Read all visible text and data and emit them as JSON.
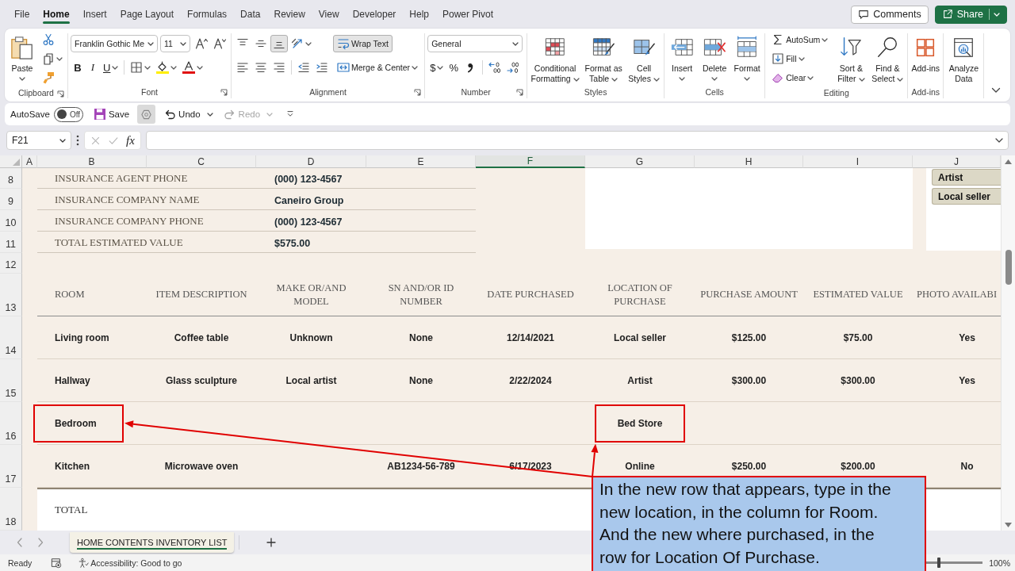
{
  "menu_tabs": [
    {
      "label": "File",
      "selected": false
    },
    {
      "label": "Home",
      "selected": true
    },
    {
      "label": "Insert",
      "selected": false
    },
    {
      "label": "Page Layout",
      "selected": false
    },
    {
      "label": "Formulas",
      "selected": false
    },
    {
      "label": "Data",
      "selected": false
    },
    {
      "label": "Review",
      "selected": false
    },
    {
      "label": "View",
      "selected": false
    },
    {
      "label": "Developer",
      "selected": false
    },
    {
      "label": "Help",
      "selected": false
    },
    {
      "label": "Power Pivot",
      "selected": false
    }
  ],
  "header_buttons": [
    {
      "label": "Comments",
      "kind": "outline"
    },
    {
      "label": "Share",
      "kind": "primary"
    }
  ],
  "ribbon": {
    "groups": [
      {
        "label": "Clipboard",
        "launcher": true,
        "sections": [
          {
            "kind": "large",
            "label": "Paste",
            "caret": true
          },
          {
            "kind": "stack",
            "lines": [
              {
                "items": [
                  {
                    "kind": "icon"
                  }
                ]
              },
              {
                "items": [
                  {
                    "kind": "icon",
                    "caret": true
                  }
                ]
              },
              {
                "items": [
                  {
                    "kind": "icon"
                  }
                ]
              }
            ]
          }
        ]
      },
      {
        "label": "Font",
        "launcher": true,
        "sections": [
          {
            "kind": "stack",
            "lines": [
              {
                "items": [
                  {
                    "kind": "dropdown",
                    "value": "Franklin Gothic Me"
                  },
                  {
                    "kind": "dropdown",
                    "value": "11"
                  },
                  {
                    "kind": "icon"
                  },
                  {
                    "kind": "icon"
                  }
                ]
              },
              {
                "items": [
                  {
                    "kind": "bold",
                    "label": "B"
                  },
                  {
                    "kind": "italic",
                    "label": "I"
                  },
                  {
                    "kind": "underline",
                    "label": "U",
                    "caret": true
                  },
                  {
                    "kind": "divider"
                  },
                  {
                    "kind": "icon",
                    "caret": true
                  },
                  {
                    "kind": "icon",
                    "caret": true
                  },
                  {
                    "kind": "icon",
                    "caret": true
                  }
                ]
              }
            ]
          }
        ]
      },
      {
        "label": "Alignment",
        "launcher": true,
        "sections": [
          {
            "kind": "stack",
            "lines": [
              {
                "items": [
                  {
                    "kind": "icon",
                    "selected": false
                  },
                  {
                    "kind": "icon",
                    "selected": false
                  },
                  {
                    "kind": "icon",
                    "selected": true
                  },
                  {
                    "kind": "icon",
                    "caret": true
                  }
                ]
              },
              {
                "items": [
                  {
                    "kind": "icon",
                    "selected": false
                  },
                  {
                    "kind": "icon",
                    "selected": false
                  },
                  {
                    "kind": "icon",
                    "selected": false
                  },
                  {
                    "kind": "divider"
                  },
                  {
                    "kind": "icon"
                  },
                  {
                    "kind": "icon"
                  }
                ]
              }
            ]
          },
          {
            "kind": "stack",
            "lines": [
              {
                "items": [
                  {
                    "kind": "labeled",
                    "label": "Wrap Text",
                    "selected": true
                  }
                ]
              },
              {
                "items": [
                  {
                    "kind": "labeled",
                    "label": "Merge & Center",
                    "caret": true
                  }
                ]
              }
            ]
          }
        ]
      },
      {
        "label": "Number",
        "launcher": true,
        "sections": [
          {
            "kind": "stack",
            "lines": [
              {
                "items": [
                  {
                    "kind": "dropdown",
                    "value": "General"
                  }
                ]
              },
              {
                "items": [
                  {
                    "kind": "symbol",
                    "label": "$",
                    "caret": true
                  },
                  {
                    "kind": "symbol",
                    "label": "%"
                  },
                  {
                    "kind": "icon"
                  },
                  {
                    "kind": "divider"
                  },
                  {
                    "kind": "icon"
                  },
                  {
                    "kind": "icon"
                  }
                ]
              }
            ]
          }
        ]
      },
      {
        "label": "Styles",
        "sections": [
          {
            "kind": "large",
            "label": "Conditional Formatting",
            "caret": true
          },
          {
            "kind": "large",
            "label": "Format as Table",
            "caret": true
          },
          {
            "kind": "large",
            "label": "Cell Styles",
            "caret": true
          }
        ]
      },
      {
        "label": "Cells",
        "sections": [
          {
            "kind": "large",
            "label": "Insert",
            "caret": true
          },
          {
            "kind": "large",
            "label": "Delete",
            "caret": true
          },
          {
            "kind": "large",
            "label": "Format",
            "caret": true
          }
        ]
      },
      {
        "label": "Editing",
        "sections": [
          {
            "kind": "stack",
            "lines": [
              {
                "items": [
                  {
                    "kind": "labeled",
                    "label": "AutoSum",
                    "caret": true
                  }
                ]
              },
              {
                "items": [
                  {
                    "kind": "labeled",
                    "label": "Fill",
                    "caret": true
                  }
                ]
              },
              {
                "items": [
                  {
                    "kind": "labeled",
                    "label": "Clear",
                    "caret": true
                  }
                ]
              }
            ]
          },
          {
            "kind": "large",
            "label": "Sort & Filter",
            "caret": true
          },
          {
            "kind": "large",
            "label": "Find & Select",
            "caret": true
          }
        ]
      },
      {
        "label": "Add-ins",
        "sections": [
          {
            "kind": "large",
            "label": "Add-ins"
          }
        ]
      },
      {
        "sections": [
          {
            "kind": "large",
            "label": "Analyze Data"
          }
        ]
      }
    ]
  },
  "quick_access": [
    {
      "kind": "toggle",
      "label": "AutoSave",
      "state": "Off",
      "on": false
    },
    {
      "kind": "button",
      "label": "Save",
      "disabled": false
    },
    {
      "kind": "icon",
      "selected": true
    },
    {
      "kind": "button",
      "label": "Undo",
      "caret": true,
      "disabled": false
    },
    {
      "kind": "button",
      "label": "Redo",
      "caret": true,
      "disabled": true
    },
    {
      "kind": "menu"
    }
  ],
  "formula_bar": {
    "name_box": "F21",
    "function_label": "fx",
    "editing": false
  },
  "columns": [
    {
      "label": "A",
      "selected": false
    },
    {
      "label": "B",
      "selected": false
    },
    {
      "label": "C",
      "selected": false
    },
    {
      "label": "D",
      "selected": false
    },
    {
      "label": "E",
      "selected": false
    },
    {
      "label": "F",
      "selected": true
    },
    {
      "label": "G",
      "selected": false
    },
    {
      "label": "H",
      "selected": false
    },
    {
      "label": "I",
      "selected": false
    },
    {
      "label": "J",
      "selected": false
    }
  ],
  "sheet": {
    "rows": [
      {
        "kind": "info",
        "number": "8",
        "label": "INSURANCE AGENT PHONE",
        "value": "(000) 123-4567"
      },
      {
        "kind": "info",
        "number": "9",
        "label": "INSURANCE COMPANY NAME",
        "value": "Caneiro Group"
      },
      {
        "kind": "info",
        "number": "10",
        "label": "INSURANCE COMPANY PHONE",
        "value": "(000) 123-4567"
      },
      {
        "kind": "info",
        "number": "11",
        "label": "TOTAL ESTIMATED VALUE",
        "value": "$575.00"
      },
      {
        "kind": "blank",
        "number": "12"
      },
      {
        "kind": "header",
        "number": "13",
        "cells": [
          "ROOM",
          "ITEM DESCRIPTION",
          "MAKE OR/AND MODEL",
          "SN AND/OR ID NUMBER",
          "DATE PURCHASED",
          "LOCATION OF PURCHASE",
          "PURCHASE AMOUNT",
          "ESTIMATED VALUE",
          "PHOTO AVAILABI"
        ]
      },
      {
        "kind": "item",
        "number": "14",
        "cells": [
          {
            "text": "Living room",
            "highlighted": false
          },
          {
            "text": "Coffee table",
            "highlighted": false
          },
          {
            "text": "Unknown",
            "highlighted": false
          },
          {
            "text": "None",
            "highlighted": false
          },
          {
            "text": "12/14/2021",
            "highlighted": false
          },
          {
            "text": "Local seller",
            "highlighted": false
          },
          {
            "text": "$125.00",
            "highlighted": false
          },
          {
            "text": "$75.00",
            "highlighted": false
          },
          {
            "text": "Yes",
            "highlighted": false
          }
        ]
      },
      {
        "kind": "item",
        "number": "15",
        "cells": [
          {
            "text": "Hallway",
            "highlighted": false
          },
          {
            "text": "Glass sculpture",
            "highlighted": false
          },
          {
            "text": "Local artist",
            "highlighted": false
          },
          {
            "text": "None",
            "highlighted": false
          },
          {
            "text": "2/22/2024",
            "highlighted": false
          },
          {
            "text": "Artist",
            "highlighted": false
          },
          {
            "text": "$300.00",
            "highlighted": false
          },
          {
            "text": "$300.00",
            "highlighted": false
          },
          {
            "text": "Yes",
            "highlighted": false
          }
        ]
      },
      {
        "kind": "item",
        "number": "16",
        "cells": [
          {
            "text": "Bedroom",
            "highlighted": true
          },
          {
            "highlighted": false
          },
          {
            "highlighted": false
          },
          {
            "highlighted": false
          },
          {
            "highlighted": false
          },
          {
            "text": "Bed Store",
            "highlighted": true
          },
          {
            "highlighted": false
          },
          {
            "highlighted": false
          },
          {
            "highlighted": false
          }
        ]
      },
      {
        "kind": "item",
        "number": "17",
        "cells": [
          {
            "text": "Kitchen",
            "highlighted": false
          },
          {
            "text": "Microwave oven",
            "highlighted": false
          },
          {
            "highlighted": false
          },
          {
            "text": "AB1234-56-789",
            "highlighted": false
          },
          {
            "text": "6/17/2023",
            "highlighted": false
          },
          {
            "text": "Online",
            "highlighted": false
          },
          {
            "text": "$250.00",
            "highlighted": false
          },
          {
            "text": "$200.00",
            "highlighted": false
          },
          {
            "text": "No",
            "highlighted": false
          }
        ]
      },
      {
        "kind": "total",
        "number": "18",
        "label": "TOTAL"
      }
    ],
    "slicer": {
      "items": [
        {
          "label": "Artist"
        },
        {
          "label": "Local seller"
        }
      ]
    }
  },
  "sheet_tabs": [
    {
      "label": "HOME CONTENTS INVENTORY LIST",
      "selected": true
    }
  ],
  "status_bar": {
    "mode": "Ready",
    "accessibility": "Accessibility: Good to go",
    "zoom": {
      "label": "100%",
      "level": 0.25
    }
  },
  "callout": {
    "text": "In the new row that appears, type in the new location, in the column for Room. And the new where purchased, in the row for Location Of Purchase."
  }
}
